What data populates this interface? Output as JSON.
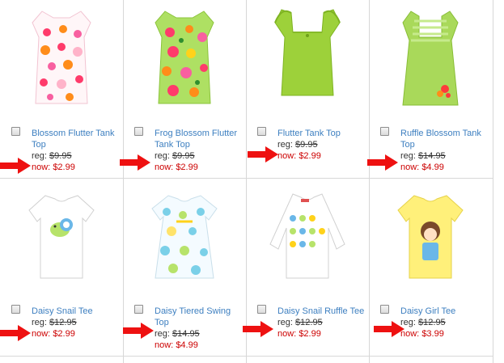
{
  "colors": {
    "link": "#3d7fc0",
    "price_now": "#cc0000",
    "arrow": "#ee1111",
    "divider": "#d7d7d7"
  },
  "products": [
    {
      "name": "Blossom Flutter Tank Top",
      "reg_label": "reg:",
      "reg_price": "$9.95",
      "now_label": "now:",
      "now_price": "$2.99",
      "image": "blossom-flutter-tank-top-image"
    },
    {
      "name": "Frog Blossom Flutter Tank Top",
      "reg_label": "reg:",
      "reg_price": "$9.95",
      "now_label": "now:",
      "now_price": "$2.99",
      "image": "frog-blossom-flutter-tank-top-image"
    },
    {
      "name": "Flutter Tank Top",
      "reg_label": "reg:",
      "reg_price": "$9.95",
      "now_label": "now:",
      "now_price": "$2.99",
      "image": "flutter-tank-top-image"
    },
    {
      "name": "Ruffle Blossom Tank Top",
      "reg_label": "reg:",
      "reg_price": "$14.95",
      "now_label": "now:",
      "now_price": "$4.99",
      "image": "ruffle-blossom-tank-top-image"
    },
    {
      "name": "Daisy Snail Tee",
      "reg_label": "reg:",
      "reg_price": "$12.95",
      "now_label": "now:",
      "now_price": "$2.99",
      "image": "daisy-snail-tee-image"
    },
    {
      "name": "Daisy Tiered Swing Top",
      "reg_label": "reg:",
      "reg_price": "$14.95",
      "now_label": "now:",
      "now_price": "$4.99",
      "image": "daisy-tiered-swing-top-image"
    },
    {
      "name": "Daisy Snail Ruffle Tee",
      "reg_label": "reg:",
      "reg_price": "$12.95",
      "now_label": "now:",
      "now_price": "$2.99",
      "image": "daisy-snail-ruffle-tee-image"
    },
    {
      "name": "Daisy Girl Tee",
      "reg_label": "reg:",
      "reg_price": "$12.95",
      "now_label": "now:",
      "now_price": "$3.99",
      "image": "daisy-girl-tee-image"
    }
  ]
}
